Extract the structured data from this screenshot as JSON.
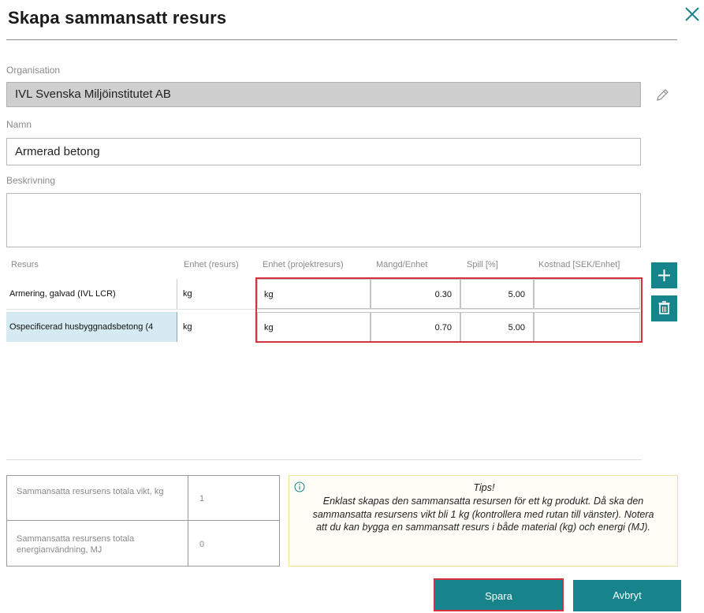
{
  "dialog": {
    "title": "Skapa sammansatt resurs",
    "close_icon": "close-icon"
  },
  "form": {
    "organisation_label": "Organisation",
    "organisation_value": "IVL Svenska Miljöinstitutet AB",
    "edit_icon": "pencil-icon",
    "name_label": "Namn",
    "name_value": "Armerad betong",
    "description_label": "Beskrivning",
    "description_value": ""
  },
  "table": {
    "headers": [
      "Resurs",
      "Enhet (resurs)",
      "Enhet (projektresurs)",
      "Mängd/Enhet",
      "Spill [%]",
      "Kostnad [SEK/Enhet]"
    ],
    "rows": [
      {
        "resource": "Armering, galvad (IVL LCR)",
        "unit_resource": "kg",
        "unit_project": "kg",
        "amount": "0.30",
        "waste": "5.00",
        "cost": "",
        "selected": false
      },
      {
        "resource": "Ospecificerad husbyggnadsbetong (4",
        "unit_resource": "kg",
        "unit_project": "kg",
        "amount": "0.70",
        "waste": "5.00",
        "cost": "",
        "selected": true
      }
    ],
    "add_icon": "plus-icon",
    "delete_icon": "trash-icon"
  },
  "summary": {
    "weight_label": "Sammansatta resursens totala vikt, kg",
    "weight_value": "1",
    "energy_label": "Sammansatta resursens totala energianvändning, MJ",
    "energy_value": "0"
  },
  "tips": {
    "icon": "info-icon",
    "title": "Tips!",
    "text": "Enklast skapas den sammansatta resursen för ett kg produkt. Då ska den sammansatta resursens vikt bli 1 kg (kontrollera med rutan till vänster). Notera att du kan bygga en sammansatt resurs i både material (kg) och energi (MJ)."
  },
  "buttons": {
    "save": "Spara",
    "cancel": "Avbryt"
  },
  "colors": {
    "accent": "#17848b",
    "highlight": "#d9303d",
    "selected_row": "#d6eaf3"
  }
}
